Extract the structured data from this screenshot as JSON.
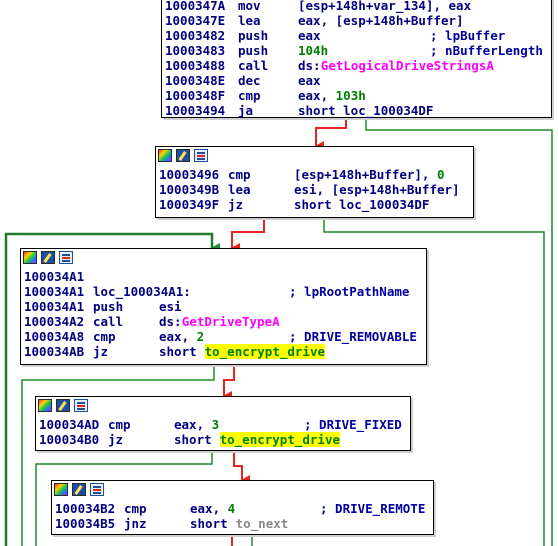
{
  "colors": {
    "text": "#000080",
    "api": "#ff00ff",
    "number": "#008000",
    "highlight": "#ffff00",
    "edge_true": "#e6231e",
    "edge_false": "#1f8a2d",
    "edge_back": "#1f8a2d"
  },
  "header_icons": [
    "color-palette-icon",
    "edit-icon",
    "graph-overview-icon"
  ],
  "blocks": {
    "b1": {
      "lines": [
        {
          "addr": "1000347A",
          "mn": "mov",
          "ops": "[esp+148h+var_134], eax",
          "cmt": ""
        },
        {
          "addr": "1000347E",
          "mn": "lea",
          "ops": "eax, [esp+148h+Buffer]",
          "cmt": ""
        },
        {
          "addr": "10003482",
          "mn": "push",
          "ops": "eax",
          "cmt": "; lpBuffer"
        },
        {
          "addr": "10003483",
          "mn": "push",
          "ops": "104h",
          "cmt": "; nBufferLength"
        },
        {
          "addr": "10003488",
          "mn": "call",
          "ops": "ds:",
          "api": "GetLogicalDriveStringsA",
          "cmt": ""
        },
        {
          "addr": "1000348E",
          "mn": "dec",
          "ops": "eax",
          "cmt": ""
        },
        {
          "addr": "1000348F",
          "mn": "cmp",
          "ops": "eax, 103h",
          "cmt": ""
        },
        {
          "addr": "10003494",
          "mn": "ja",
          "ops": "short loc_100034DF",
          "cmt": ""
        }
      ]
    },
    "b2": {
      "lines": [
        {
          "addr": "10003496",
          "mn": "cmp",
          "ops": "[esp+148h+Buffer], 0",
          "cmt": ""
        },
        {
          "addr": "1000349B",
          "mn": "lea",
          "ops": "esi, [esp+148h+Buffer]",
          "cmt": ""
        },
        {
          "addr": "1000349F",
          "mn": "jz",
          "ops": "short loc_100034DF",
          "cmt": ""
        }
      ]
    },
    "b3": {
      "lines": [
        {
          "addr": "100034A1",
          "mn": "",
          "ops": "",
          "cmt": ""
        },
        {
          "addr": "100034A1",
          "mn": "loc_100034A1:",
          "ops": "",
          "cmt": "; lpRootPathName"
        },
        {
          "addr": "100034A1",
          "mn": "push",
          "ops": "esi",
          "cmt": ""
        },
        {
          "addr": "100034A2",
          "mn": "call",
          "ops": "ds:",
          "api": "GetDriveTypeA",
          "cmt": ""
        },
        {
          "addr": "100034A8",
          "mn": "cmp",
          "ops": "eax, 2",
          "cmt": "; DRIVE_REMOVABLE"
        },
        {
          "addr": "100034AB",
          "mn": "jz",
          "ops": "short",
          "target": "to_encrypt_drive",
          "cmt": ""
        }
      ]
    },
    "b4": {
      "lines": [
        {
          "addr": "100034AD",
          "mn": "cmp",
          "ops": "eax, 3",
          "cmt": "; DRIVE_FIXED"
        },
        {
          "addr": "100034B0",
          "mn": "jz",
          "ops": "short",
          "target": "to_encrypt_drive",
          "cmt": ""
        }
      ]
    },
    "b5": {
      "lines": [
        {
          "addr": "100034B2",
          "mn": "cmp",
          "ops": "eax, 4",
          "cmt": "; DRIVE_REMOTE"
        },
        {
          "addr": "100034B5",
          "mn": "jnz",
          "ops": "short",
          "target2": "to_next",
          "cmt": ""
        }
      ]
    }
  }
}
